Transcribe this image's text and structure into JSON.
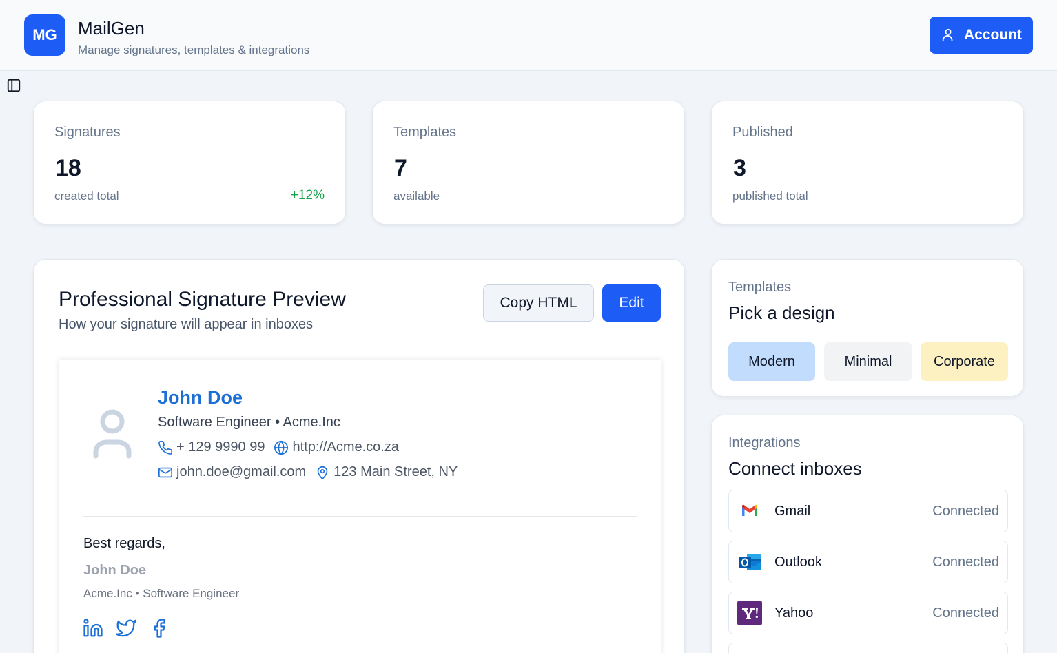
{
  "header": {
    "logo_text": "MG",
    "title": "MailGen",
    "subtitle": "Manage signatures, templates & integrations",
    "account_label": "Account"
  },
  "stats": [
    {
      "label": "Signatures",
      "value": "18",
      "caption": "created total",
      "delta": "+12%"
    },
    {
      "label": "Templates",
      "value": "7",
      "caption": "available",
      "delta": ""
    },
    {
      "label": "Published",
      "value": "3",
      "caption": "published total",
      "delta": ""
    }
  ],
  "preview": {
    "title": "Professional Signature Preview",
    "subtitle": "How your signature will appear in inboxes",
    "copy_label": "Copy HTML",
    "edit_label": "Edit",
    "signature": {
      "name": "John Doe",
      "role_line": "Software Engineer • Acme.Inc",
      "phone": "+ 129 9990 99",
      "website": "http://Acme.co.za",
      "email": "john.doe@gmail.com",
      "address": "123 Main Street, NY",
      "regards": "Best regards,",
      "footer_name": "John Doe",
      "footer_company": "Acme.Inc • Software Engineer",
      "socials": [
        "linkedin-icon",
        "twitter-icon",
        "facebook-icon"
      ]
    }
  },
  "templates": {
    "label": "Templates",
    "title": "Pick a design",
    "options": [
      {
        "label": "Modern",
        "color": "#c2dcfd"
      },
      {
        "label": "Minimal",
        "color": "#f1f3f5"
      },
      {
        "label": "Corporate",
        "color": "#fdf1c2"
      }
    ]
  },
  "integrations": {
    "label": "Integrations",
    "title": "Connect inboxes",
    "items": [
      {
        "name": "Gmail",
        "status": "Connected",
        "icon": "gmail-icon"
      },
      {
        "name": "Outlook",
        "status": "Connected",
        "icon": "outlook-icon"
      },
      {
        "name": "Yahoo",
        "status": "Connected",
        "icon": "yahoo-icon"
      }
    ]
  },
  "colors": {
    "primary": "#1d5cf5",
    "success": "#16a34a",
    "signature_name": "#1d6fd8"
  }
}
